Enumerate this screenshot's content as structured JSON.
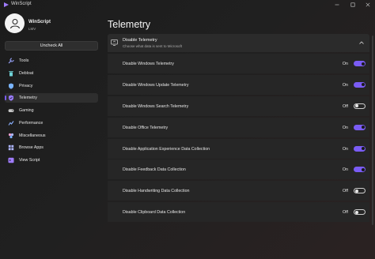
{
  "window": {
    "title": "WinScript",
    "minimize_icon": "minimize-icon",
    "maximize_icon": "maximize-icon",
    "close_icon": "close-icon"
  },
  "profile": {
    "name": "WinScript",
    "subtitle": "LMV",
    "avatar_icon": "user-avatar-icon"
  },
  "sidebar": {
    "uncheck_label": "Uncheck All",
    "items": [
      {
        "label": "Tools",
        "icon": "wrench-icon",
        "color": "#9aa6ff"
      },
      {
        "label": "Debloat",
        "icon": "trash-icon",
        "color": "#6fd3d8"
      },
      {
        "label": "Privacy",
        "icon": "shield-icon",
        "color": "#7ab4ff"
      },
      {
        "label": "Telemetry",
        "icon": "telemetry-shield-icon",
        "color": "#9a7cff",
        "active": true
      },
      {
        "label": "Gaming",
        "icon": "gamepad-icon",
        "color": "#c7c7c7"
      },
      {
        "label": "Performance",
        "icon": "gauge-icon",
        "color": "#8ab0ff"
      },
      {
        "label": "Miscellaneous",
        "icon": "puzzle-icon",
        "color": "#f0a0d0"
      },
      {
        "label": "Browse Apps",
        "icon": "apps-grid-icon",
        "color": "#b0b8ff"
      },
      {
        "label": "View Script",
        "icon": "terminal-icon",
        "color": "#a07cff"
      }
    ]
  },
  "main": {
    "title": "Telemetry",
    "section": {
      "title": "Disable Telemetry",
      "subtitle": "Choose what data is sent to Microsoft",
      "expanded": true
    },
    "rows": [
      {
        "label": "Disable Windows Telemetry",
        "state": "On",
        "on": true
      },
      {
        "label": "Disable Windows Update Telemetry",
        "state": "On",
        "on": true
      },
      {
        "label": "Disable Windows Search Telemetry",
        "state": "Off",
        "on": false
      },
      {
        "label": "Disable Office Telemetry",
        "state": "On",
        "on": true
      },
      {
        "label": "Disable Application Experience Data Collection",
        "state": "On",
        "on": true
      },
      {
        "label": "Disable Feedback Data Collection",
        "state": "On",
        "on": true
      },
      {
        "label": "Disable Handwriting Data Collection",
        "state": "Off",
        "on": false
      },
      {
        "label": "Disable Clipboard Data Collection",
        "state": "Off",
        "on": false
      }
    ]
  },
  "colors": {
    "accent": "#7a5cf5",
    "background": "#1f1f1f",
    "row": "#262626"
  }
}
